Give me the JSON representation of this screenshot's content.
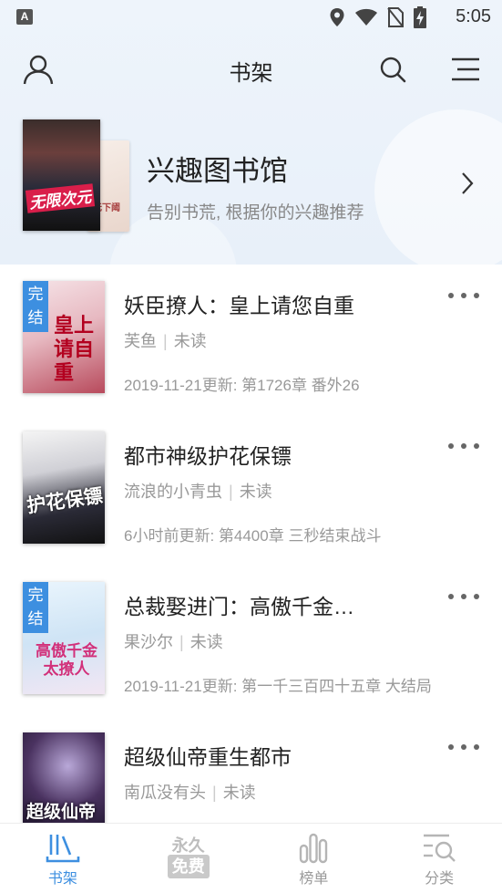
{
  "status_bar": {
    "time": "5:05",
    "app_badge": "A"
  },
  "header": {
    "title": "书架"
  },
  "library_banner": {
    "title": "兴趣图书馆",
    "description": "告别书荒, 根据你的兴趣推荐",
    "cover_logo": "无限次元",
    "back_cover_text": "无下阈"
  },
  "books": [
    {
      "title": "妖臣撩人：皇上请您自重",
      "author": "芙鱼",
      "status": "未读",
      "update": "2019-11-21更新: 第1726章   番外26",
      "tag": "完结",
      "cover_text": "皇上 请自重",
      "cover_colors": [
        "#f3dfe3",
        "#c85a6a"
      ]
    },
    {
      "title": "都市神级护花保镖",
      "author": "流浪的小青虫",
      "status": "未读",
      "update": "6小时前更新: 第4400章 三秒结束战斗",
      "tag": "",
      "cover_text": "护花保镖",
      "cover_colors": [
        "#e9e9e9",
        "#1b1b24"
      ]
    },
    {
      "title": "总裁娶进门：高傲千金…",
      "author": "果沙尔",
      "status": "未读",
      "update": "2019-11-21更新: 第一千三百四十五章   大结局",
      "tag": "完结",
      "cover_text": "高傲千金 太撩人",
      "cover_colors": [
        "#e4f1fb",
        "#b9d6ee"
      ]
    },
    {
      "title": "超级仙帝重生都市",
      "author": "南瓜没有头",
      "status": "未读",
      "update": "",
      "tag": "",
      "cover_text": "超级仙帝",
      "cover_colors": [
        "#4a3260",
        "#0d0a18"
      ]
    }
  ],
  "bottom_nav": [
    {
      "label": "书架",
      "active": true
    },
    {
      "label": "",
      "badge_top": "永久",
      "badge_bottom": "免费",
      "active": false
    },
    {
      "label": "榜单",
      "active": false
    },
    {
      "label": "分类",
      "active": false
    }
  ],
  "colors": {
    "accent": "#3d8fe0",
    "muted_text": "#999999",
    "banner_bg": "#eef4fb"
  }
}
